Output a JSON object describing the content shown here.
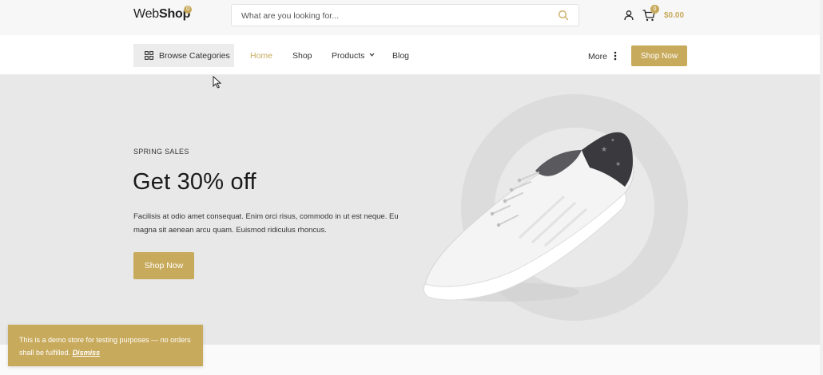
{
  "colors": {
    "accent": "#c8aa5c",
    "hero_bg": "#e8e8e8",
    "topbar_bg": "#f7f7f7"
  },
  "header": {
    "logo_light": "Web",
    "logo_bold": "Shop",
    "logo_badge": "0",
    "search_placeholder": "What are you looking for...",
    "cart_count": "0",
    "cart_total": "$0.00",
    "icons": [
      "search-icon",
      "user-icon",
      "cart-icon"
    ]
  },
  "nav": {
    "browse_label": "Browse Categories",
    "links": [
      {
        "label": "Home",
        "active": true
      },
      {
        "label": "Shop",
        "active": false
      },
      {
        "label": "Products",
        "active": false
      },
      {
        "label": "Blog",
        "active": false
      }
    ],
    "more_label": "More",
    "cta_label": "Shop Now"
  },
  "hero": {
    "eyebrow": "SPRING SALES",
    "headline": "Get 30% off",
    "description": "Facilisis at odio amet consequat. Enim orci risus, commodo in ut est neque. Eu magna sit aenean arcu quam. Euismod ridiculus rhoncus.",
    "cta_label": "Shop Now"
  },
  "demo_notice": {
    "text": "This is a demo store for testing purposes — no orders shall be fulfilled.",
    "dismiss_label": "Dismiss"
  }
}
